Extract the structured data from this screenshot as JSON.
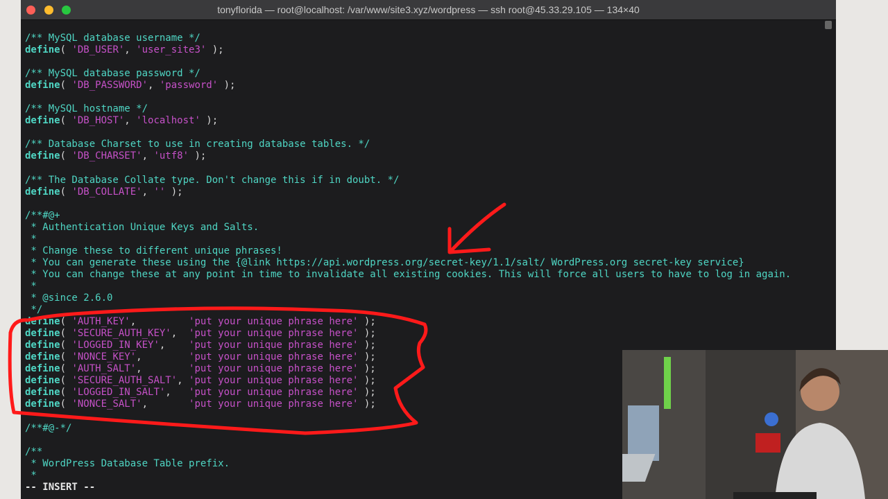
{
  "window": {
    "title": "tonyflorida — root@localhost: /var/www/site3.xyz/wordpress — ssh root@45.33.29.105 — 134×40",
    "traffic_lights": {
      "close": "#fe5f57",
      "minimize": "#febc2e",
      "zoom": "#28c840"
    }
  },
  "colors": {
    "comment": "#4fd6c4",
    "string": "#c651c8",
    "background": "#1c1c1e",
    "annotation": "#ff1a1a"
  },
  "editor": {
    "mode": "-- INSERT --",
    "lines": [
      [
        [
          "cm",
          "/** MySQL database username */"
        ]
      ],
      [
        [
          "kw",
          "define"
        ],
        [
          "pl",
          "( "
        ],
        [
          "st",
          "'DB_USER'"
        ],
        [
          "pl",
          ", "
        ],
        [
          "st",
          "'user_site3'"
        ],
        [
          "pl",
          " );"
        ]
      ],
      [],
      [
        [
          "cm",
          "/** MySQL database password */"
        ]
      ],
      [
        [
          "kw",
          "define"
        ],
        [
          "pl",
          "( "
        ],
        [
          "st",
          "'DB_PASSWORD'"
        ],
        [
          "pl",
          ", "
        ],
        [
          "st",
          "'password'"
        ],
        [
          "pl",
          " );"
        ]
      ],
      [],
      [
        [
          "cm",
          "/** MySQL hostname */"
        ]
      ],
      [
        [
          "kw",
          "define"
        ],
        [
          "pl",
          "( "
        ],
        [
          "st",
          "'DB_HOST'"
        ],
        [
          "pl",
          ", "
        ],
        [
          "st",
          "'localhost'"
        ],
        [
          "pl",
          " );"
        ]
      ],
      [],
      [
        [
          "cm",
          "/** Database Charset to use in creating database tables. */"
        ]
      ],
      [
        [
          "kw",
          "define"
        ],
        [
          "pl",
          "( "
        ],
        [
          "st",
          "'DB_CHARSET'"
        ],
        [
          "pl",
          ", "
        ],
        [
          "st",
          "'utf8'"
        ],
        [
          "pl",
          " );"
        ]
      ],
      [],
      [
        [
          "cm",
          "/** The Database Collate type. Don't change this if in doubt. */"
        ]
      ],
      [
        [
          "kw",
          "define"
        ],
        [
          "pl",
          "( "
        ],
        [
          "st",
          "'DB_COLLATE'"
        ],
        [
          "pl",
          ", "
        ],
        [
          "st",
          "''"
        ],
        [
          "pl",
          " );"
        ]
      ],
      [],
      [
        [
          "cm",
          "/**#@+"
        ]
      ],
      [
        [
          "cm",
          " * Authentication Unique Keys and Salts."
        ]
      ],
      [
        [
          "cm",
          " *"
        ]
      ],
      [
        [
          "cm",
          " * Change these to different unique phrases!"
        ]
      ],
      [
        [
          "cm",
          " * You can generate these using the {@link https://api.wordpress.org/secret-key/1.1/salt/ WordPress.org secret-key service}"
        ]
      ],
      [
        [
          "cm",
          " * You can change these at any point in time to invalidate all existing cookies. This will force all users to have to log in again."
        ]
      ],
      [
        [
          "cm",
          " *"
        ]
      ],
      [
        [
          "cm",
          " * @since 2.6.0"
        ]
      ],
      [
        [
          "cm",
          " */"
        ]
      ],
      [
        [
          "kw",
          "define"
        ],
        [
          "pl",
          "( "
        ],
        [
          "st",
          "'AUTH_KEY'"
        ],
        [
          "pl",
          ",         "
        ],
        [
          "st",
          "'put your unique phrase here'"
        ],
        [
          "pl",
          " );"
        ]
      ],
      [
        [
          "kw",
          "define"
        ],
        [
          "pl",
          "( "
        ],
        [
          "st",
          "'SECURE_AUTH_KEY'"
        ],
        [
          "pl",
          ",  "
        ],
        [
          "st",
          "'put your unique phrase here'"
        ],
        [
          "pl",
          " );"
        ]
      ],
      [
        [
          "kw",
          "define"
        ],
        [
          "pl",
          "( "
        ],
        [
          "st",
          "'LOGGED_IN_KEY'"
        ],
        [
          "pl",
          ",    "
        ],
        [
          "st",
          "'put your unique phrase here'"
        ],
        [
          "pl",
          " );"
        ]
      ],
      [
        [
          "kw",
          "define"
        ],
        [
          "pl",
          "( "
        ],
        [
          "st",
          "'NONCE_KEY'"
        ],
        [
          "pl",
          ",        "
        ],
        [
          "st",
          "'put your unique phrase here'"
        ],
        [
          "pl",
          " );"
        ]
      ],
      [
        [
          "kw",
          "define"
        ],
        [
          "pl",
          "( "
        ],
        [
          "st",
          "'AUTH_SALT'"
        ],
        [
          "pl",
          ",        "
        ],
        [
          "st",
          "'put your unique phrase here'"
        ],
        [
          "pl",
          " );"
        ]
      ],
      [
        [
          "kw",
          "define"
        ],
        [
          "pl",
          "( "
        ],
        [
          "st",
          "'SECURE_AUTH_SALT'"
        ],
        [
          "pl",
          ", "
        ],
        [
          "st",
          "'put your unique phrase here'"
        ],
        [
          "pl",
          " );"
        ]
      ],
      [
        [
          "kw",
          "define"
        ],
        [
          "pl",
          "( "
        ],
        [
          "st",
          "'LOGGED_IN_SALT'"
        ],
        [
          "pl",
          ",   "
        ],
        [
          "st",
          "'put your unique phrase here'"
        ],
        [
          "pl",
          " );"
        ]
      ],
      [
        [
          "kw",
          "define"
        ],
        [
          "pl",
          "( "
        ],
        [
          "st",
          "'NONCE_SALT'"
        ],
        [
          "pl",
          ",       "
        ],
        [
          "st",
          "'put your unique phrase here'"
        ],
        [
          "pl",
          " );"
        ]
      ],
      [],
      [
        [
          "cm",
          "/**#@-*/"
        ]
      ],
      [],
      [
        [
          "cm",
          "/**"
        ]
      ],
      [
        [
          "cm",
          " * WordPress Database Table prefix."
        ]
      ],
      [
        [
          "cm",
          " *"
        ]
      ]
    ]
  }
}
